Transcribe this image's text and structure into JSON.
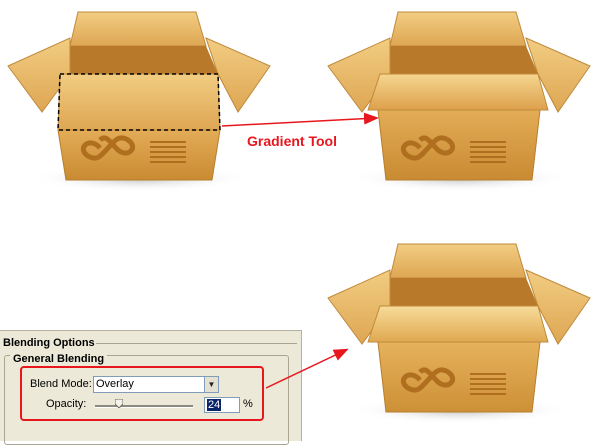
{
  "annotation": {
    "step_label": "Gradient Tool",
    "accent_color": "#e8161d"
  },
  "boxes": [
    {
      "name": "box-with-selection",
      "state": "open flaps, dashed marquee selection on front flap",
      "icon": "infinity-icon"
    },
    {
      "name": "box-after-gradient",
      "state": "open flaps, gradient applied to front flap",
      "icon": "infinity-icon"
    },
    {
      "name": "box-after-overlay",
      "state": "open flaps, overlay blend applied",
      "icon": "infinity-icon"
    }
  ],
  "blending_panel": {
    "title": "Blending Options",
    "group_title": "General Blending",
    "blend_mode_label": "Blend Mode:",
    "blend_mode_value": "Overlay",
    "opacity_label": "Opacity:",
    "opacity_value": "24",
    "opacity_unit": "%",
    "opacity_fraction": 0.24
  }
}
